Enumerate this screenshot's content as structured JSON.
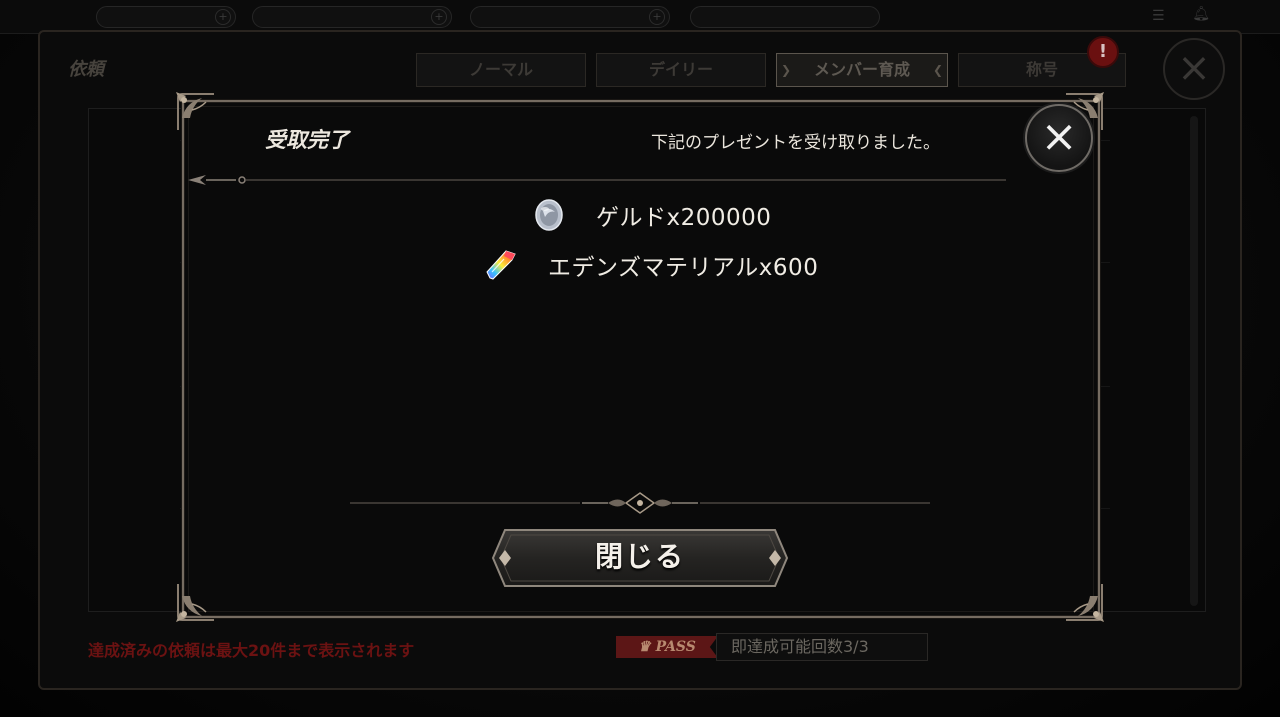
{
  "background": {
    "screen_title": "依頼",
    "tabs": [
      {
        "label": "ノーマル",
        "active": false
      },
      {
        "label": "デイリー",
        "active": false
      },
      {
        "label": "メンバー育成",
        "active": true
      },
      {
        "label": "称号",
        "active": false
      }
    ],
    "alert_badge": "!",
    "footer_note": "達成済みの依頼は最大20件まで表示されます",
    "pass_badge": "PASS",
    "instant_complete": "即達成可能回数3/3"
  },
  "modal": {
    "title": "受取完了",
    "message": "下記のプレゼントを受け取りました。",
    "close_icon": "close-icon",
    "rewards": [
      {
        "icon": "silver-coin-icon",
        "text": "ゲルドx200000"
      },
      {
        "icon": "rainbow-crystal-icon",
        "text": "エデンズマテリアルx600"
      }
    ],
    "close_button_label": "閉じる"
  },
  "colors": {
    "frame_border": "#766c61",
    "modal_bg": "#0a0a0a",
    "text": "#ece7de",
    "accent_red": "#6b1212"
  }
}
